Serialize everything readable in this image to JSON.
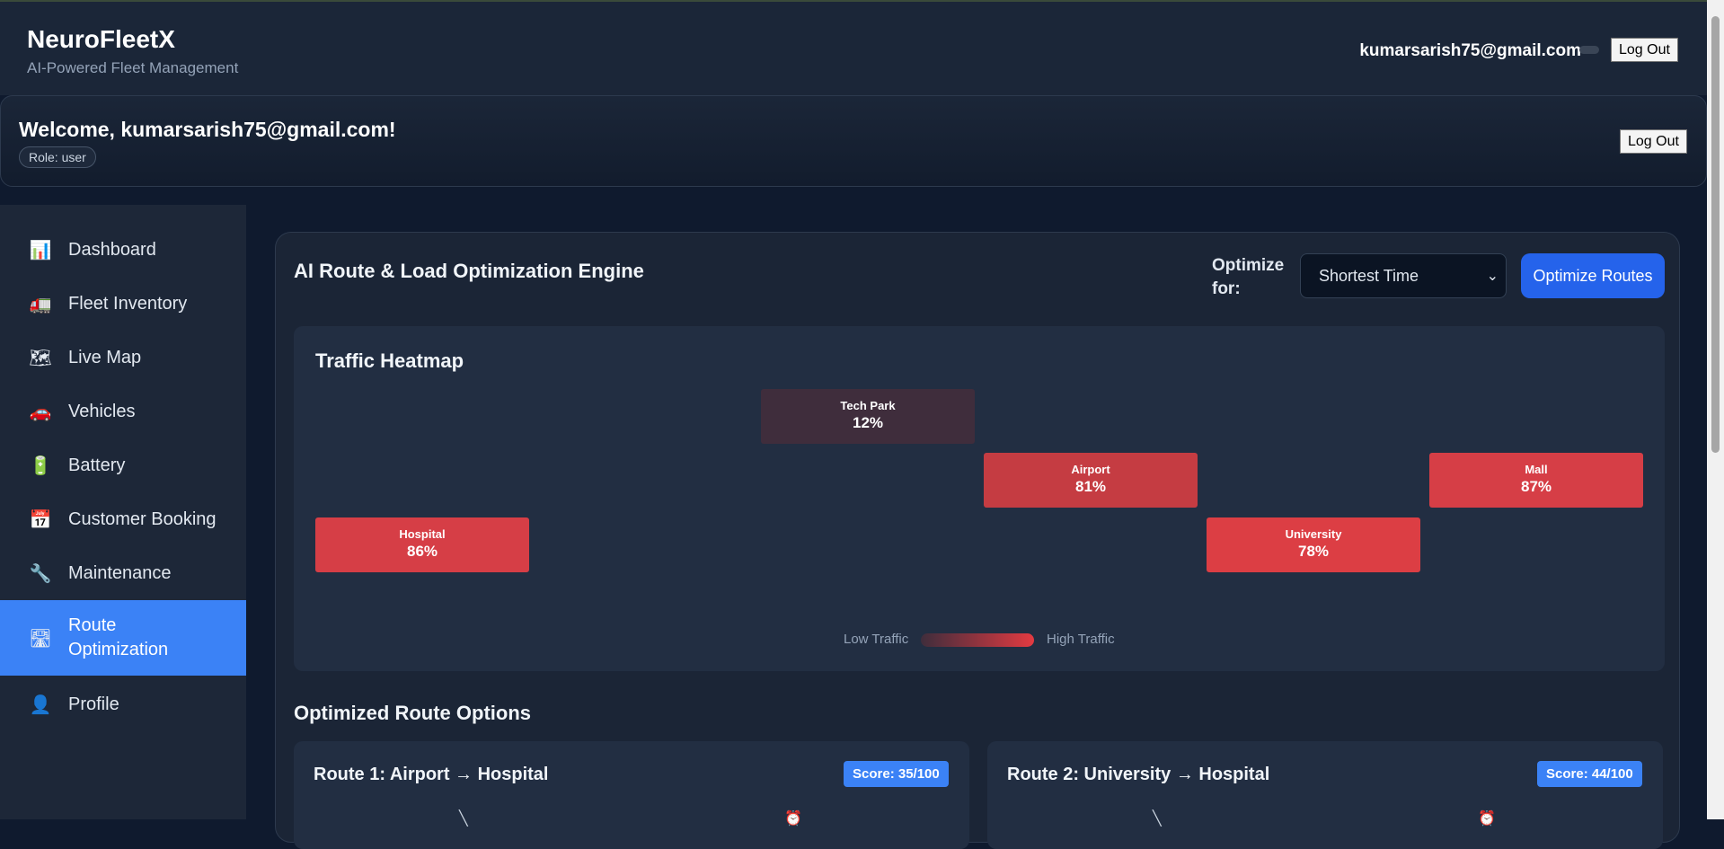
{
  "app": {
    "title": "NeuroFleetX",
    "subtitle": "AI-Powered Fleet Management",
    "user_email": "kumarsarish75@gmail.com",
    "logout_label": "Log Out"
  },
  "welcome": {
    "title": "Welcome, kumarsarish75@gmail.com!",
    "role": "Role: user",
    "logout_label": "Log Out"
  },
  "sidebar": {
    "items": [
      {
        "label": "Dashboard",
        "icon": "bar-chart-icon",
        "glyph": "📊"
      },
      {
        "label": "Fleet Inventory",
        "icon": "truck-icon",
        "glyph": "🚛"
      },
      {
        "label": "Live Map",
        "icon": "map-icon",
        "glyph": "🗺"
      },
      {
        "label": "Vehicles",
        "icon": "car-icon",
        "glyph": "🚗"
      },
      {
        "label": "Battery",
        "icon": "battery-icon",
        "glyph": "🔋"
      },
      {
        "label": "Customer Booking",
        "icon": "calendar-icon",
        "glyph": "📅"
      },
      {
        "label": "Maintenance",
        "icon": "wrench-icon",
        "glyph": "🔧"
      },
      {
        "label": "Route Optimization",
        "icon": "road-icon",
        "glyph": "🛣"
      },
      {
        "label": "Profile",
        "icon": "user-icon",
        "glyph": "👤"
      }
    ],
    "active_index": 7
  },
  "engine": {
    "title": "AI Route & Load Optimization Engine",
    "optimize_label": "Optimize for:",
    "optimize_value": "Shortest Time",
    "optimize_button": "Optimize Routes"
  },
  "heatmap": {
    "title": "Traffic Heatmap",
    "cells": [
      {
        "name": "Tech Park",
        "pct": "12%",
        "color": "#3f2d3c"
      },
      {
        "name": "Airport",
        "pct": "81%",
        "color": "#c53c42"
      },
      {
        "name": "Mall",
        "pct": "87%",
        "color": "#d63e46"
      },
      {
        "name": "Hospital",
        "pct": "86%",
        "color": "#d63e46"
      },
      {
        "name": "University",
        "pct": "78%",
        "color": "#dc3e44"
      }
    ],
    "legend_low": "Low Traffic",
    "legend_high": "High Traffic"
  },
  "routes": {
    "title": "Optimized Route Options",
    "items": [
      {
        "name": "Route 1: Airport → Hospital",
        "score": "Score: 35/100"
      },
      {
        "name": "Route 2: University → Hospital",
        "score": "Score: 44/100"
      }
    ]
  },
  "colors": {
    "accent": "#3b82f6",
    "primary_button": "#2563eb",
    "background": "#0f1a2e",
    "panel": "#1b2536"
  }
}
